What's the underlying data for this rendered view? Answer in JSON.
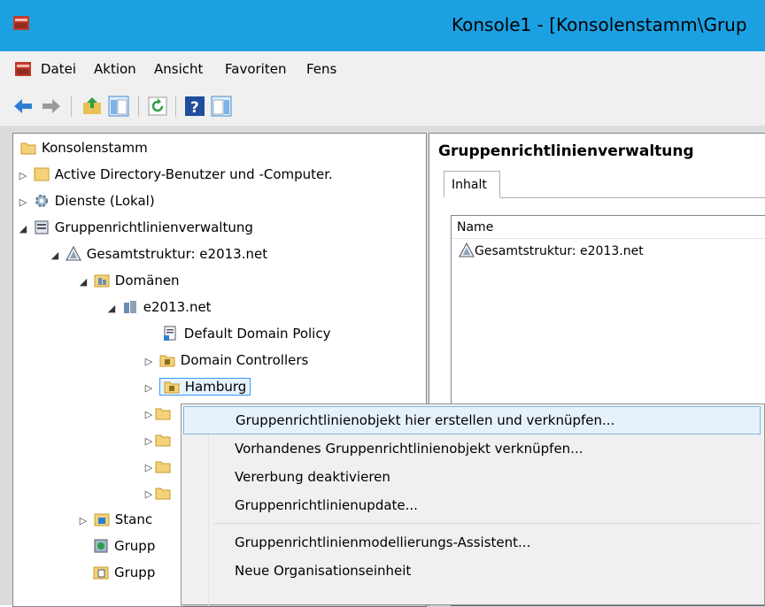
{
  "window": {
    "title": "Konsole1 - [Konsolenstamm\\Grup"
  },
  "menu": [
    "Datei",
    "Aktion",
    "Ansicht",
    "Favoriten",
    "Fens"
  ],
  "toolbar_icons": [
    "back-arrow-icon",
    "forward-arrow-icon",
    "up-folder-icon",
    "show-hide-tree-icon",
    "refresh-icon",
    "help-icon",
    "show-hide-action-pane-icon"
  ],
  "tree": {
    "root": "Konsolenstamm",
    "items": [
      "Active Directory-Benutzer und -Computer.",
      "Dienste (Lokal)",
      "Gruppenrichtlinienverwaltung",
      "Gesamtstruktur: e2013.net",
      "Domänen",
      "e2013.net",
      "Default Domain Policy",
      "Domain Controllers",
      "Hamburg"
    ],
    "partial": [
      "Stanc",
      "Grupp",
      "Grupp"
    ]
  },
  "right": {
    "title": "Gruppenrichtlinienverwaltung",
    "tab": "Inhalt",
    "column": "Name",
    "rows": [
      "Gesamtstruktur: e2013.net"
    ]
  },
  "context_menu": [
    "Gruppenrichtlinienobjekt hier erstellen und verknüpfen...",
    "Vorhandenes Gruppenrichtlinienobjekt verknüpfen...",
    "Vererbung deaktivieren",
    "Gruppenrichtlinienupdate...",
    "Gruppenrichtlinienmodellierungs-Assistent...",
    "Neue Organisationseinheit"
  ],
  "colors": {
    "titlebar": "#1ba1e2",
    "menu_bg": "#f0f0f0",
    "selection": "#e5f1fb",
    "selection_border": "#7db9e8"
  }
}
